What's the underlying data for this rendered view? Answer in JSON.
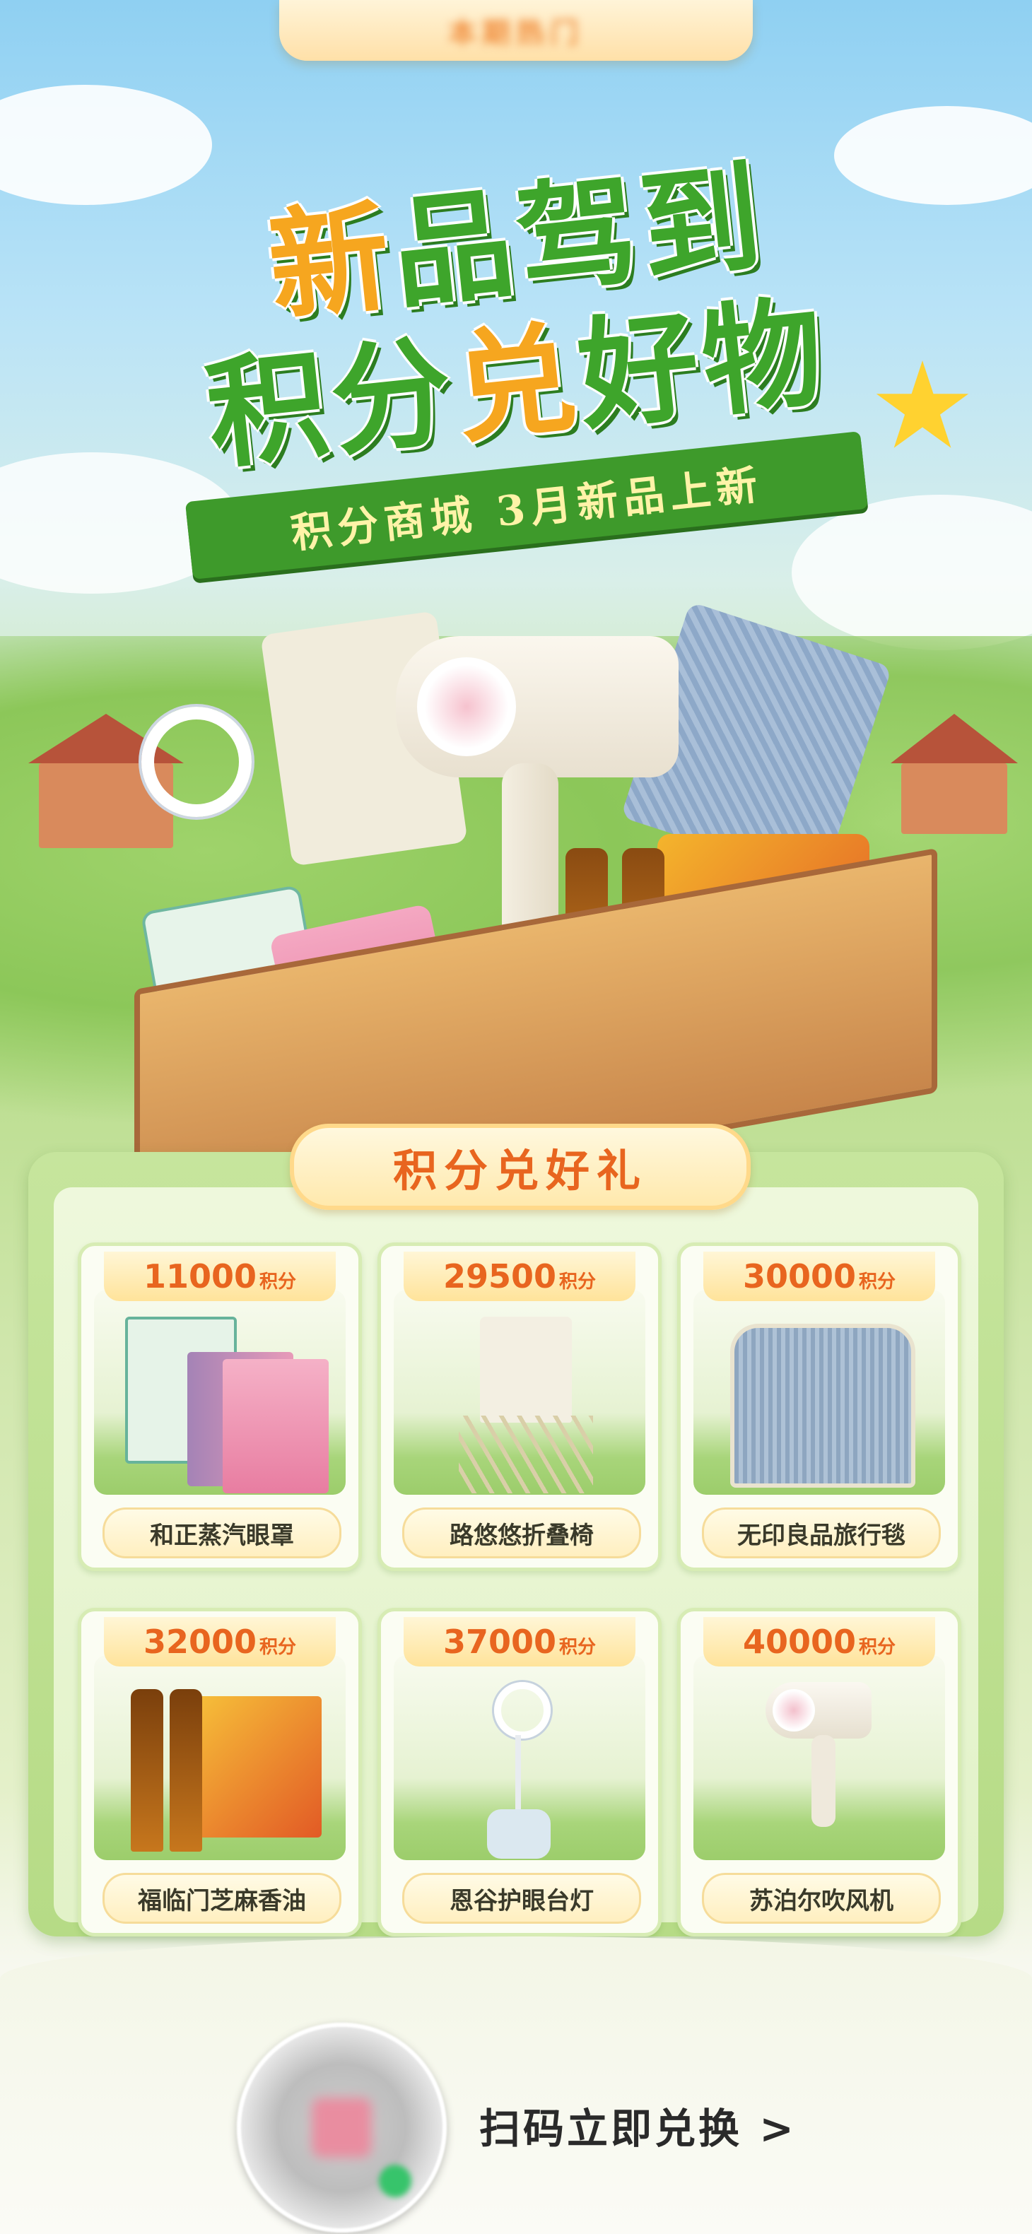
{
  "top_tab": {
    "label": "本期热门"
  },
  "hero": {
    "line1_accent": "新",
    "line1_rest": "品驾到",
    "line2_a": "积分",
    "line2_accent": "兑",
    "line2_b": "好物",
    "subtitle": "积分商城 3月新品上新"
  },
  "section": {
    "title": "积分兑好礼"
  },
  "points_unit": "积分",
  "products": [
    {
      "points": "11000",
      "name": "和正蒸汽眼罩"
    },
    {
      "points": "29500",
      "name": "路悠悠折叠椅"
    },
    {
      "points": "30000",
      "name": "无印良品旅行毯"
    },
    {
      "points": "32000",
      "name": "福临门芝麻香油"
    },
    {
      "points": "37000",
      "name": "恩谷护眼台灯"
    },
    {
      "points": "40000",
      "name": "苏泊尔吹风机"
    }
  ],
  "footer": {
    "cta": "扫码立即兑换 >"
  },
  "colors": {
    "accent_green": "#3ea52b",
    "accent_orange": "#e8651f",
    "gold": "#f6a61f"
  }
}
